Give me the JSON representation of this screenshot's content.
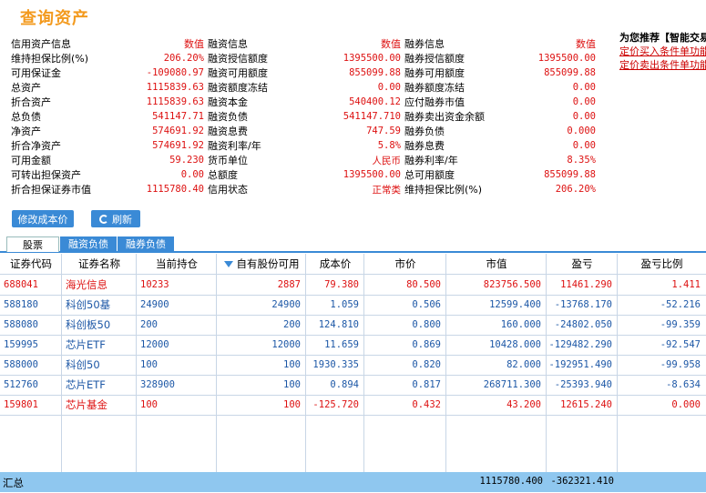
{
  "title": "查询资产",
  "info": {
    "col1": {
      "header": "信用资产信息",
      "header_val": "数值",
      "rows": [
        {
          "label": "维持担保比例(%)",
          "value": "206.20%"
        },
        {
          "label": "可用保证金",
          "value": "-109080.97"
        },
        {
          "label": "总资产",
          "value": "1115839.63"
        },
        {
          "label": "折合资产",
          "value": "1115839.63"
        },
        {
          "label": "总负债",
          "value": "541147.71"
        },
        {
          "label": "净资产",
          "value": "574691.92"
        },
        {
          "label": "折合净资产",
          "value": "574691.92"
        },
        {
          "label": "可用金额",
          "value": "59.230"
        },
        {
          "label": "可转出担保资产",
          "value": "0.00"
        },
        {
          "label": "折合担保证券市值",
          "value": "1115780.40"
        }
      ]
    },
    "col2": {
      "header": "融资信息",
      "header_val": "数值",
      "rows": [
        {
          "label": "融资授信额度",
          "value": "1395500.00"
        },
        {
          "label": "融资可用额度",
          "value": "855099.88"
        },
        {
          "label": "融资额度冻结",
          "value": "0.00"
        },
        {
          "label": "融资本金",
          "value": "540400.12"
        },
        {
          "label": "融资负债",
          "value": "541147.710"
        },
        {
          "label": "融资息费",
          "value": "747.59"
        },
        {
          "label": "融资利率/年",
          "value": "5.8%"
        },
        {
          "label": "货币单位",
          "value": "人民币"
        },
        {
          "label": "总额度",
          "value": "1395500.00"
        },
        {
          "label": "信用状态",
          "value": "正常类"
        }
      ]
    },
    "col3": {
      "header": "融券信息",
      "header_val": "数值",
      "rows": [
        {
          "label": "融券授信额度",
          "value": "1395500.00"
        },
        {
          "label": "融券可用额度",
          "value": "855099.88"
        },
        {
          "label": "融券额度冻结",
          "value": "0.00"
        },
        {
          "label": "应付融券市值",
          "value": "0.00"
        },
        {
          "label": "融券卖出资金余额",
          "value": "0.00"
        },
        {
          "label": "融券负债",
          "value": "0.000"
        },
        {
          "label": "融券息费",
          "value": "0.00"
        },
        {
          "label": "融券利率/年",
          "value": "8.35%"
        },
        {
          "label": "总可用额度",
          "value": "855099.88"
        },
        {
          "label": "维持担保比例(%)",
          "value": "206.20%"
        }
      ]
    }
  },
  "recommend": {
    "title": "为您推荐【智能交易】",
    "link1": "定价买入条件单功能",
    "link2": "定价卖出条件单功能"
  },
  "buttons": {
    "edit_cost": "修改成本价",
    "refresh": "刷新"
  },
  "tabs": [
    "股票",
    "融资负债",
    "融券负债"
  ],
  "table": {
    "headers": [
      "证券代码",
      "证券名称",
      "当前持仓",
      "自有股份可用",
      "成本价",
      "市价",
      "市值",
      "盈亏",
      "盈亏比例"
    ],
    "rows": [
      {
        "code": "688041",
        "name": "海光信息",
        "hold": "10233",
        "own": "2887",
        "cost": "79.380",
        "price": "80.500",
        "mv": "823756.500",
        "pl": "11461.290",
        "ratio": "1.411",
        "color": "red"
      },
      {
        "code": "588180",
        "name": "科创50基",
        "hold": "24900",
        "own": "24900",
        "cost": "1.059",
        "price": "0.506",
        "mv": "12599.400",
        "pl": "-13768.170",
        "ratio": "-52.216",
        "color": "blue"
      },
      {
        "code": "588080",
        "name": "科创板50",
        "hold": "200",
        "own": "200",
        "cost": "124.810",
        "price": "0.800",
        "mv": "160.000",
        "pl": "-24802.050",
        "ratio": "-99.359",
        "color": "blue"
      },
      {
        "code": "159995",
        "name": "芯片ETF",
        "hold": "12000",
        "own": "12000",
        "cost": "11.659",
        "price": "0.869",
        "mv": "10428.000",
        "pl": "-129482.290",
        "ratio": "-92.547",
        "color": "blue"
      },
      {
        "code": "588000",
        "name": "科创50",
        "hold": "100",
        "own": "100",
        "cost": "1930.335",
        "price": "0.820",
        "mv": "82.000",
        "pl": "-192951.490",
        "ratio": "-99.958",
        "color": "blue"
      },
      {
        "code": "512760",
        "name": "芯片ETF",
        "hold": "328900",
        "own": "100",
        "cost": "0.894",
        "price": "0.817",
        "mv": "268711.300",
        "pl": "-25393.940",
        "ratio": "-8.634",
        "color": "blue"
      },
      {
        "code": "159801",
        "name": "芯片基金",
        "hold": "100",
        "own": "100",
        "cost": "-125.720",
        "price": "0.432",
        "mv": "43.200",
        "pl": "12615.240",
        "ratio": "0.000",
        "color": "red"
      }
    ],
    "summary": {
      "label": "汇总",
      "mv": "1115780.400",
      "pl": "-362321.410"
    }
  }
}
